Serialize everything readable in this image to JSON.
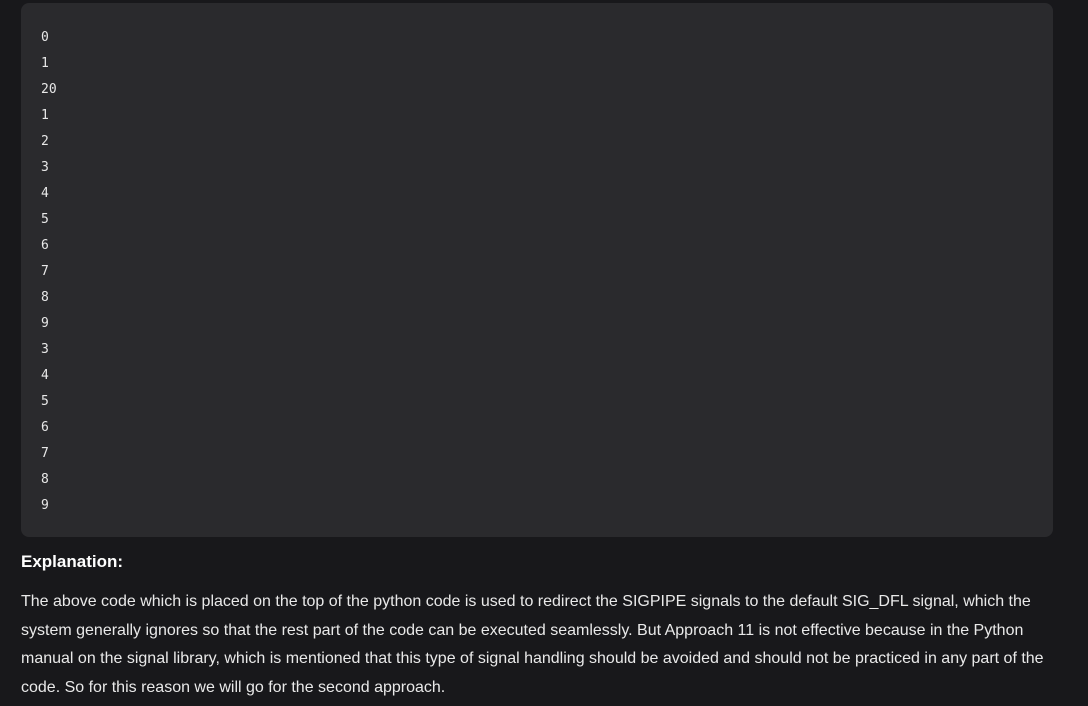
{
  "code_output": {
    "lines": [
      "0",
      "1",
      "20",
      "1",
      "2",
      "3",
      "4",
      "5",
      "6",
      "7",
      "8",
      "9",
      "3",
      "4",
      "5",
      "6",
      "7",
      "8",
      "9"
    ]
  },
  "explanation": {
    "heading": "Explanation:",
    "text": "The above code which is placed on the top of the python code is used to redirect the SIGPIPE signals to the default SIG_DFL signal, which the system generally ignores so that the rest part of the code can be executed seamlessly. But Approach 11 is not effective because in the Python manual on the signal library, which is mentioned that this type of signal handling should be avoided and should not be practiced in any part of the code. So for this reason we will go for the second approach."
  }
}
